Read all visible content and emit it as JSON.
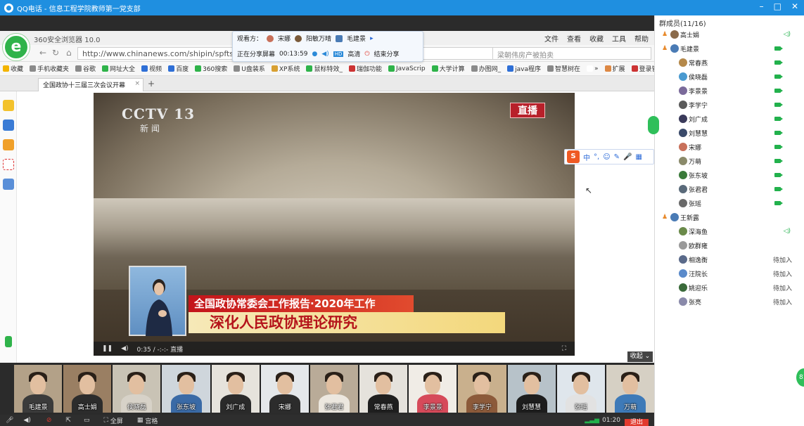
{
  "qq_window": {
    "title": "QQ电话 - 信息工程学院教师第一党支部",
    "controls": [
      "–",
      "□",
      "✕"
    ]
  },
  "browser": {
    "name": "360安全浏览器 10.0",
    "menu": [
      "文件",
      "查看",
      "收藏",
      "工具",
      "帮助"
    ],
    "url": "http://www.chinanews.com/shipin/spfts/20",
    "search_placeholder": "梁朝伟房产被拍卖",
    "bookmarks": [
      {
        "label": "收藏",
        "color": "#f3b400"
      },
      {
        "label": "手机收藏夹",
        "color": "#8a8a8a"
      },
      {
        "label": "谷歌",
        "color": "#8a8a8a"
      },
      {
        "label": "网址大全",
        "color": "#2fb34a"
      },
      {
        "label": "视频",
        "color": "#2f6fd6"
      },
      {
        "label": "百度",
        "color": "#2f6fd6"
      },
      {
        "label": "360搜索",
        "color": "#2fb34a"
      },
      {
        "label": "U盘装系",
        "color": "#8a8a8a"
      },
      {
        "label": "XP系统",
        "color": "#d8a032"
      },
      {
        "label": "鼠标特效_",
        "color": "#2fb34a"
      },
      {
        "label": "瑞伽功能",
        "color": "#c33"
      },
      {
        "label": "JavaScrip",
        "color": "#2fb34a"
      },
      {
        "label": "大学计算",
        "color": "#2fb34a"
      },
      {
        "label": "办图网_",
        "color": "#8a8a8a"
      },
      {
        "label": "java程序",
        "color": "#2f6fd6"
      },
      {
        "label": "智慧树在",
        "color": "#888"
      },
      {
        "label": "»",
        "color": "#ffffff"
      },
      {
        "label": "扩展",
        "color": "#d84"
      },
      {
        "label": "登录管家",
        "color": "#c33"
      }
    ],
    "active_tab": "全国政协十三届三次会议开幕",
    "new_tab": "+"
  },
  "share_bar": {
    "viewers_label": "观看方：",
    "viewers": [
      "宋娜",
      "阳敏万晴",
      "毛建景"
    ],
    "status": "正在分享屏幕",
    "time": "00:13:59",
    "quality": "高清",
    "stop": "结束分享"
  },
  "video": {
    "channel": "CCTV 13",
    "channel_sub": "新 闻",
    "live": "直播",
    "caption_top": "全国政协常委会工作报告·2020年工作",
    "caption_main": "深化人民政协理论研究",
    "time": "0:35 / -:-:- 直播"
  },
  "sogou": {
    "logo": "S",
    "items": [
      "中",
      "°,",
      "☺",
      "✎",
      "🎤",
      "▦"
    ]
  },
  "members_panel": {
    "title": "群成员(11/16)",
    "members": [
      {
        "name": "高士娟",
        "crown": true,
        "cam": false,
        "mic": true,
        "status": "",
        "color": "#8a6a4a"
      },
      {
        "name": "毛建景",
        "crown": true,
        "cam": true,
        "mic": false,
        "status": "",
        "color": "#4a7bb5"
      },
      {
        "name": "常春燕",
        "crown": false,
        "cam": true,
        "mic": false,
        "status": "",
        "color": "#b5894a"
      },
      {
        "name": "侯晓磊",
        "crown": false,
        "cam": true,
        "mic": false,
        "status": "",
        "color": "#4a9ad0"
      },
      {
        "name": "李景景",
        "crown": false,
        "cam": true,
        "mic": false,
        "status": "",
        "color": "#7a6a9a"
      },
      {
        "name": "李学宁",
        "crown": false,
        "cam": true,
        "mic": false,
        "status": "",
        "color": "#5a5a5a"
      },
      {
        "name": "刘广成",
        "crown": false,
        "cam": true,
        "mic": false,
        "status": "",
        "color": "#3a3a5a"
      },
      {
        "name": "刘慧慧",
        "crown": false,
        "cam": true,
        "mic": false,
        "status": "",
        "color": "#3a4a6a"
      },
      {
        "name": "宋娜",
        "crown": false,
        "cam": true,
        "mic": false,
        "status": "",
        "color": "#c8705a"
      },
      {
        "name": "万萌",
        "crown": false,
        "cam": true,
        "mic": false,
        "status": "",
        "color": "#8a8a6a"
      },
      {
        "name": "张东坡",
        "crown": false,
        "cam": true,
        "mic": false,
        "status": "",
        "color": "#3a7a3a"
      },
      {
        "name": "张君君",
        "crown": false,
        "cam": true,
        "mic": false,
        "status": "",
        "color": "#5a6a7a"
      },
      {
        "name": "张瑶",
        "crown": false,
        "cam": true,
        "mic": false,
        "status": "",
        "color": "#6a6a6a"
      },
      {
        "name": "王新露",
        "crown": true,
        "cam": false,
        "mic": false,
        "status": "",
        "color": "#4a7bb5"
      },
      {
        "name": "深海鱼",
        "crown": false,
        "cam": false,
        "mic": true,
        "status": "",
        "color": "#6a8a4a"
      },
      {
        "name": "欧群雍",
        "crown": false,
        "cam": false,
        "mic": false,
        "status": "",
        "color": "#9a9a9a"
      },
      {
        "name": "相逸衡",
        "crown": false,
        "cam": false,
        "mic": false,
        "status": "待加入",
        "color": "#5a6a8a"
      },
      {
        "name": "汪院长",
        "crown": false,
        "cam": false,
        "mic": false,
        "status": "待加入",
        "color": "#5a8aca"
      },
      {
        "name": "姚迎乐",
        "crown": false,
        "cam": false,
        "mic": false,
        "status": "待加入",
        "color": "#3a6a3a"
      },
      {
        "name": "张亮",
        "crown": false,
        "cam": false,
        "mic": false,
        "status": "待加入",
        "color": "#8a8aaa"
      }
    ]
  },
  "video_strip": {
    "collapse": "收起",
    "tiles": [
      {
        "name": "毛建景",
        "bg": "#b3a188",
        "shirt": "#3b3b3b"
      },
      {
        "name": "高士娟",
        "bg": "#9a7f63",
        "shirt": "#2c2c2c"
      },
      {
        "name": "侯晓磊",
        "bg": "#c9c3b5",
        "shirt": "#d7d2c8"
      },
      {
        "name": "张东坡",
        "bg": "#cfd6dc",
        "shirt": "#3a6aa6"
      },
      {
        "name": "刘广成",
        "bg": "#e6e3dc",
        "shirt": "#2a2a2a"
      },
      {
        "name": "宋娜",
        "bg": "#e4e7ea",
        "shirt": "#2c2c2c"
      },
      {
        "name": "张君君",
        "bg": "#b9ab98",
        "shirt": "#ece7df"
      },
      {
        "name": "常春燕",
        "bg": "#e5e2dc",
        "shirt": "#1f1f1f"
      },
      {
        "name": "李景景",
        "bg": "#f0ece6",
        "shirt": "#d64a5a"
      },
      {
        "name": "李学宁",
        "bg": "#c9b08d",
        "shirt": "#8c5a3a"
      },
      {
        "name": "刘慧慧",
        "bg": "#b7c2c9",
        "shirt": "#1d1d1d"
      },
      {
        "name": "张瑶",
        "bg": "#dfe6ec",
        "shirt": "#e2e2e2"
      },
      {
        "name": "万萌",
        "bg": "#d6d0c4",
        "shirt": "#3e7ab8"
      }
    ]
  },
  "bottom_bar": {
    "fullscreen": "全屏",
    "grid": "宫格",
    "duration": "01:20",
    "exit": "退出"
  },
  "floating_badge": "81"
}
